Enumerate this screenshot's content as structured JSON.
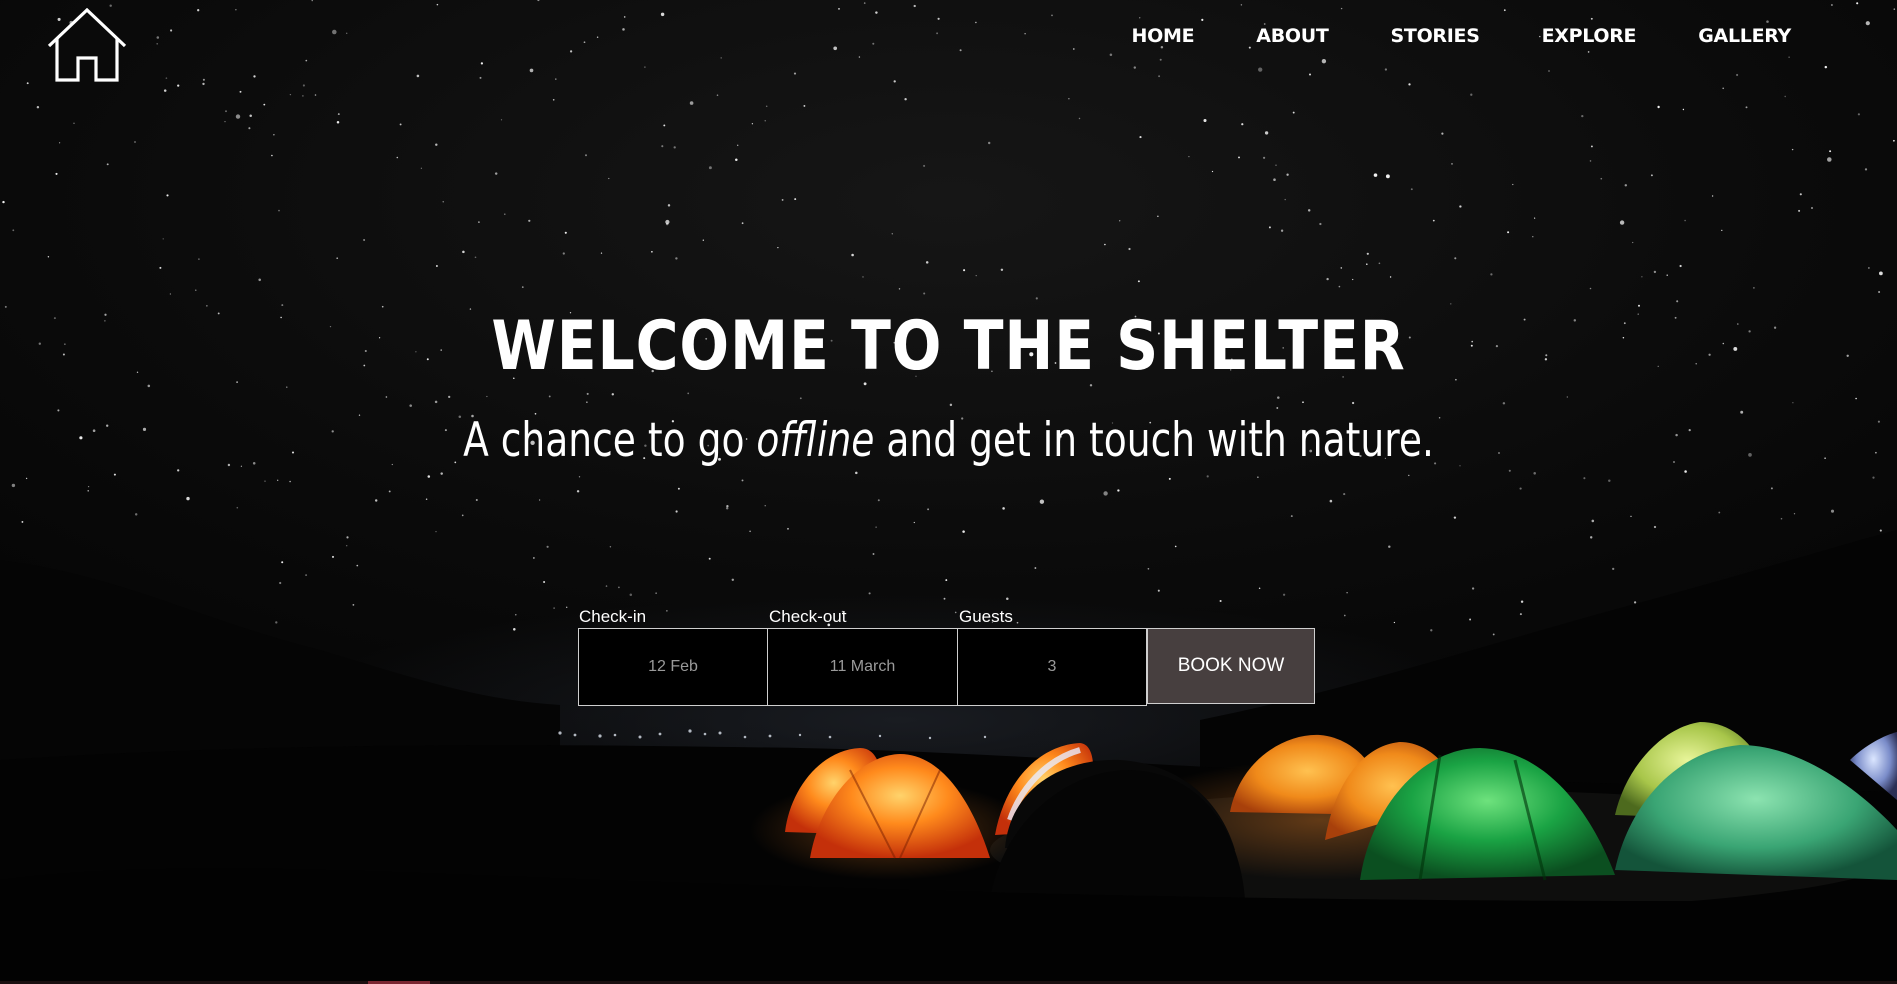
{
  "nav": {
    "logo_icon": "house-icon",
    "items": [
      {
        "label": "HOME"
      },
      {
        "label": "ABOUT"
      },
      {
        "label": "STORIES"
      },
      {
        "label": "EXPLORE"
      },
      {
        "label": "GALLERY"
      }
    ]
  },
  "hero": {
    "title": "WELCOME TO THE SHELTER",
    "tagline_start": "A chance to go ",
    "tagline_emphasis": "offline",
    "tagline_end": " and get in touch with nature."
  },
  "booking": {
    "checkin_label": "Check-in",
    "checkin_value": "12 Feb",
    "checkout_label": "Check-out",
    "checkout_value": "11 March",
    "guests_label": "Guests",
    "guests_value": "3",
    "button_label": "BOOK NOW"
  },
  "colors": {
    "button_bg": "#473f3f",
    "tent_orange": "#ff7a18",
    "tent_green": "#19b24a",
    "tent_yellow_green": "#b8d65a"
  }
}
